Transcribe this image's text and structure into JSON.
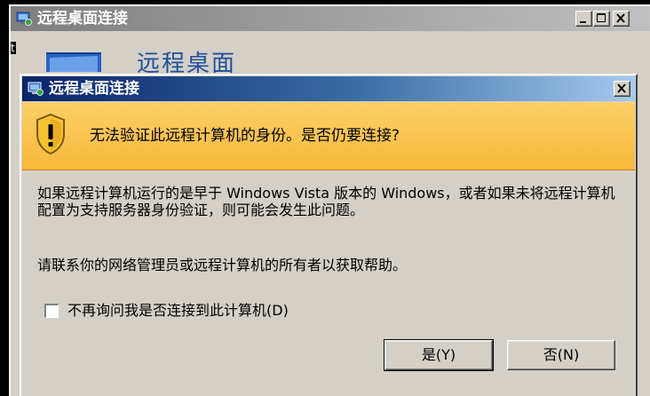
{
  "background_window": {
    "title": "远程桌面连接",
    "edge_fragment": "t",
    "header_text": "远程桌面",
    "minimize_icon": "minimize-icon",
    "maximize_icon": "maximize-icon",
    "close_icon": "close-icon",
    "app_icon": "remote-desktop-icon"
  },
  "dialog": {
    "title": "远程桌面连接",
    "app_icon": "remote-desktop-icon",
    "close_icon": "close-icon",
    "warning": {
      "icon": "warning-shield-icon",
      "text": "无法验证此远程计算机的身份。是否仍要连接?"
    },
    "message": "如果远程计算机运行的是早于 Windows Vista 版本的 Windows，或者如果未将远程计算机配置为支持服务器身份验证，则可能会发生此问题。",
    "help_text": "请联系你的网络管理员或远程计算机的所有者以获取帮助。",
    "checkbox": {
      "label": "不再询问我是否连接到此计算机(D)",
      "checked": false
    },
    "buttons": {
      "yes_label": "是(Y)",
      "no_label": "否(N)"
    }
  },
  "colors": {
    "active_title_start": "#0a246a",
    "active_title_end": "#a6caf0",
    "inactive_title_start": "#7e7e7e",
    "warning_bar": "#f8b83a",
    "window_face": "#d4d0c8",
    "header_blue": "#1e4f99"
  }
}
